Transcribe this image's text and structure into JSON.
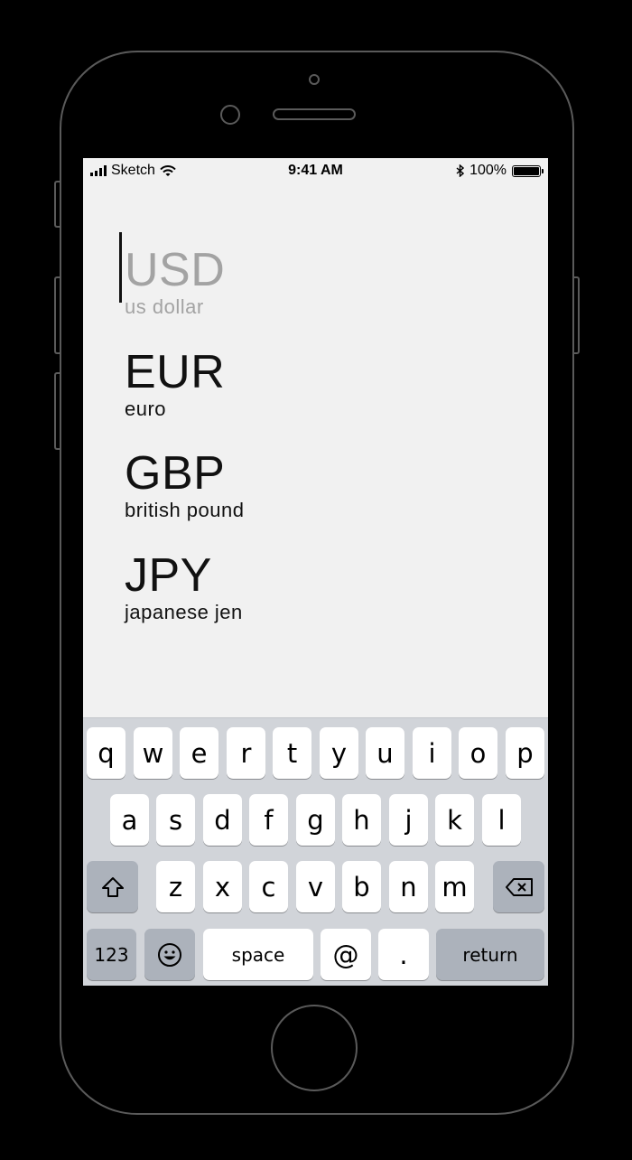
{
  "status_bar": {
    "carrier": "Sketch",
    "time": "9:41 AM",
    "battery_percent": "100%",
    "signal_icon": "signal-bars-icon",
    "wifi_icon": "wifi-icon",
    "bluetooth_icon": "bluetooth-icon",
    "battery_icon": "battery-icon"
  },
  "currencies": [
    {
      "code": "USD",
      "name": "us dollar",
      "state": "placeholder"
    },
    {
      "code": "EUR",
      "name": "euro"
    },
    {
      "code": "GBP",
      "name": "british pound"
    },
    {
      "code": "JPY",
      "name": "japanese jen"
    }
  ],
  "keyboard": {
    "row1": [
      "q",
      "w",
      "e",
      "r",
      "t",
      "y",
      "u",
      "i",
      "o",
      "p"
    ],
    "row2": [
      "a",
      "s",
      "d",
      "f",
      "g",
      "h",
      "j",
      "k",
      "l"
    ],
    "row3": [
      "z",
      "x",
      "c",
      "v",
      "b",
      "n",
      "m"
    ],
    "numbers_label": "123",
    "space_label": "space",
    "at_label": "@",
    "period_label": ".",
    "return_label": "return",
    "shift_icon": "shift-icon",
    "delete_icon": "delete-icon",
    "emoji_icon": "emoji-icon"
  },
  "colors": {
    "screen_bg": "#f1f1f1",
    "keyboard_bg": "#d1d4d9",
    "placeholder_text": "#a3a3a3",
    "phone_outline": "#5a5a5a"
  }
}
